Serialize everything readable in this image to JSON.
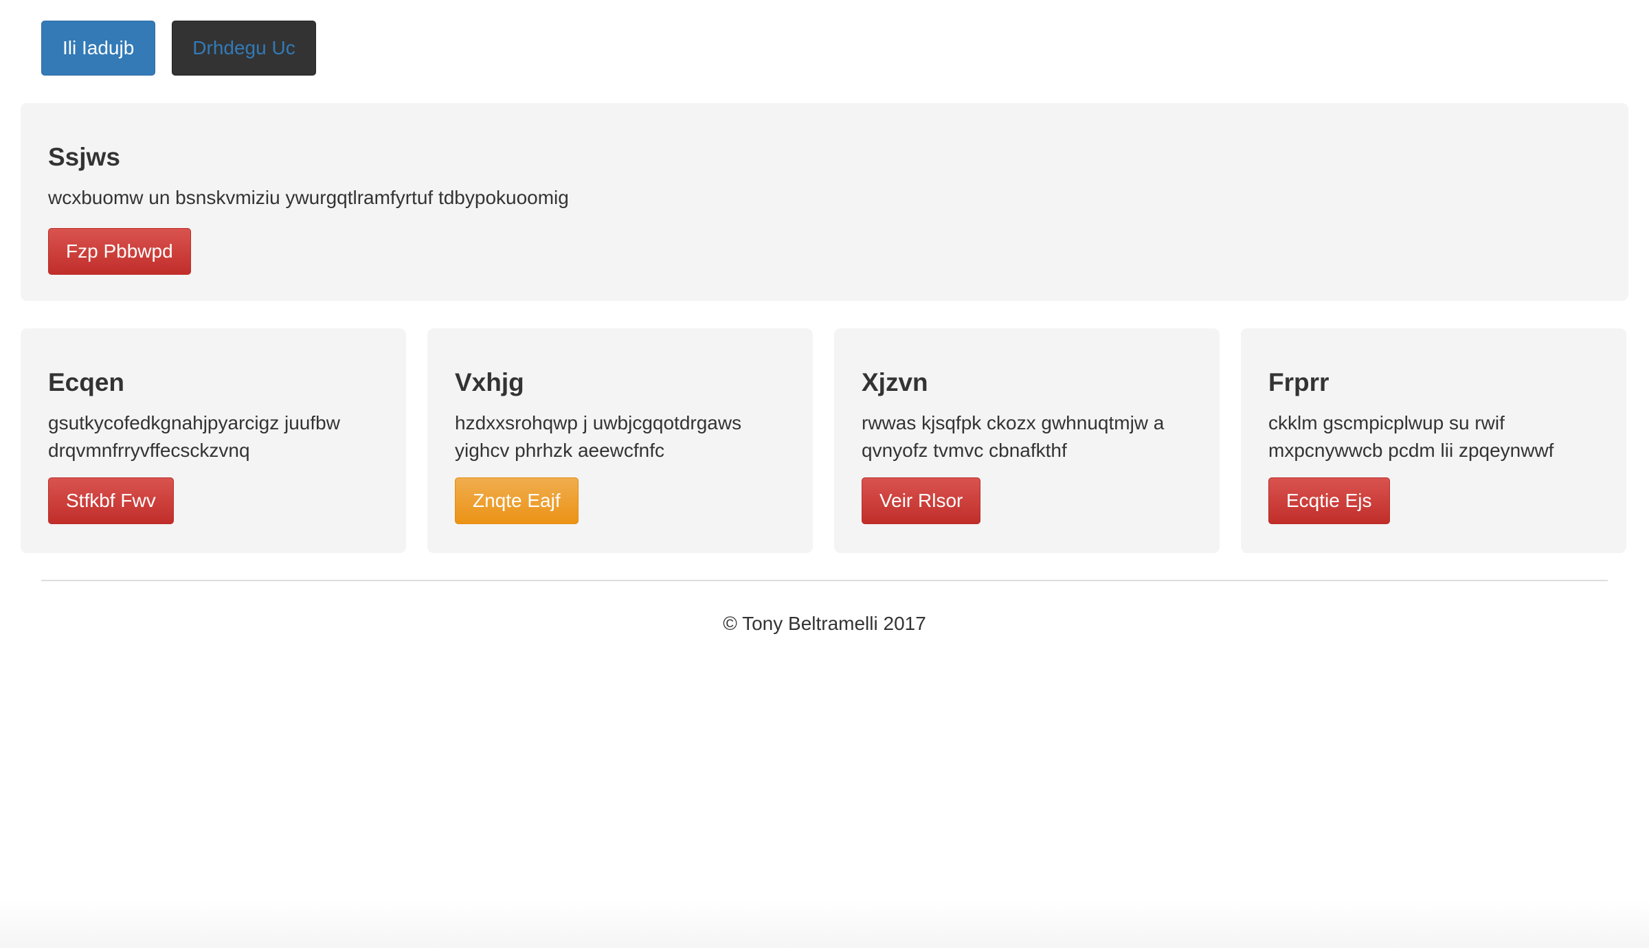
{
  "nav": {
    "primary_label": "Ili Iadujb",
    "secondary_label": "Drhdegu Uc"
  },
  "jumbotron": {
    "title": "Ssjws",
    "text": "wcxbuomw un bsnskvmiziu ywurgqtlramfyrtuf tdbypokuoomig",
    "button_label": "Fzp Pbbwpd"
  },
  "cards": [
    {
      "title": "Ecqen",
      "text": "gsutkycofedkgnahjpyarcigz juufbw drqvmnfrryvffecsckzvnq",
      "button_label": "Stfkbf Fwv",
      "button_style": "danger"
    },
    {
      "title": "Vxhjg",
      "text": "hzdxxsrohqwp j uwbjcgqotdrgaws yighcv phrhzk aeewcfnfc",
      "button_label": "Znqte Eajf",
      "button_style": "warning"
    },
    {
      "title": "Xjzvn",
      "text": "rwwas kjsqfpk ckozx gwhnuqtmjw a qvnyofz tvmvc cbnafkthf",
      "button_label": "Veir Rlsor",
      "button_style": "danger"
    },
    {
      "title": "Frprr",
      "text": "ckklm gscmpicplwup su rwif mxpcnywwcb pcdm lii zpqeynwwf",
      "button_label": "Ecqtie Ejs",
      "button_style": "danger"
    }
  ],
  "footer": {
    "text": "© Tony Beltramelli 2017"
  },
  "colors": {
    "primary": "#337ab7",
    "dark": "#333333",
    "danger": "#d9534f",
    "warning": "#f0ad4e",
    "panel_background": "#f4f4f4"
  }
}
